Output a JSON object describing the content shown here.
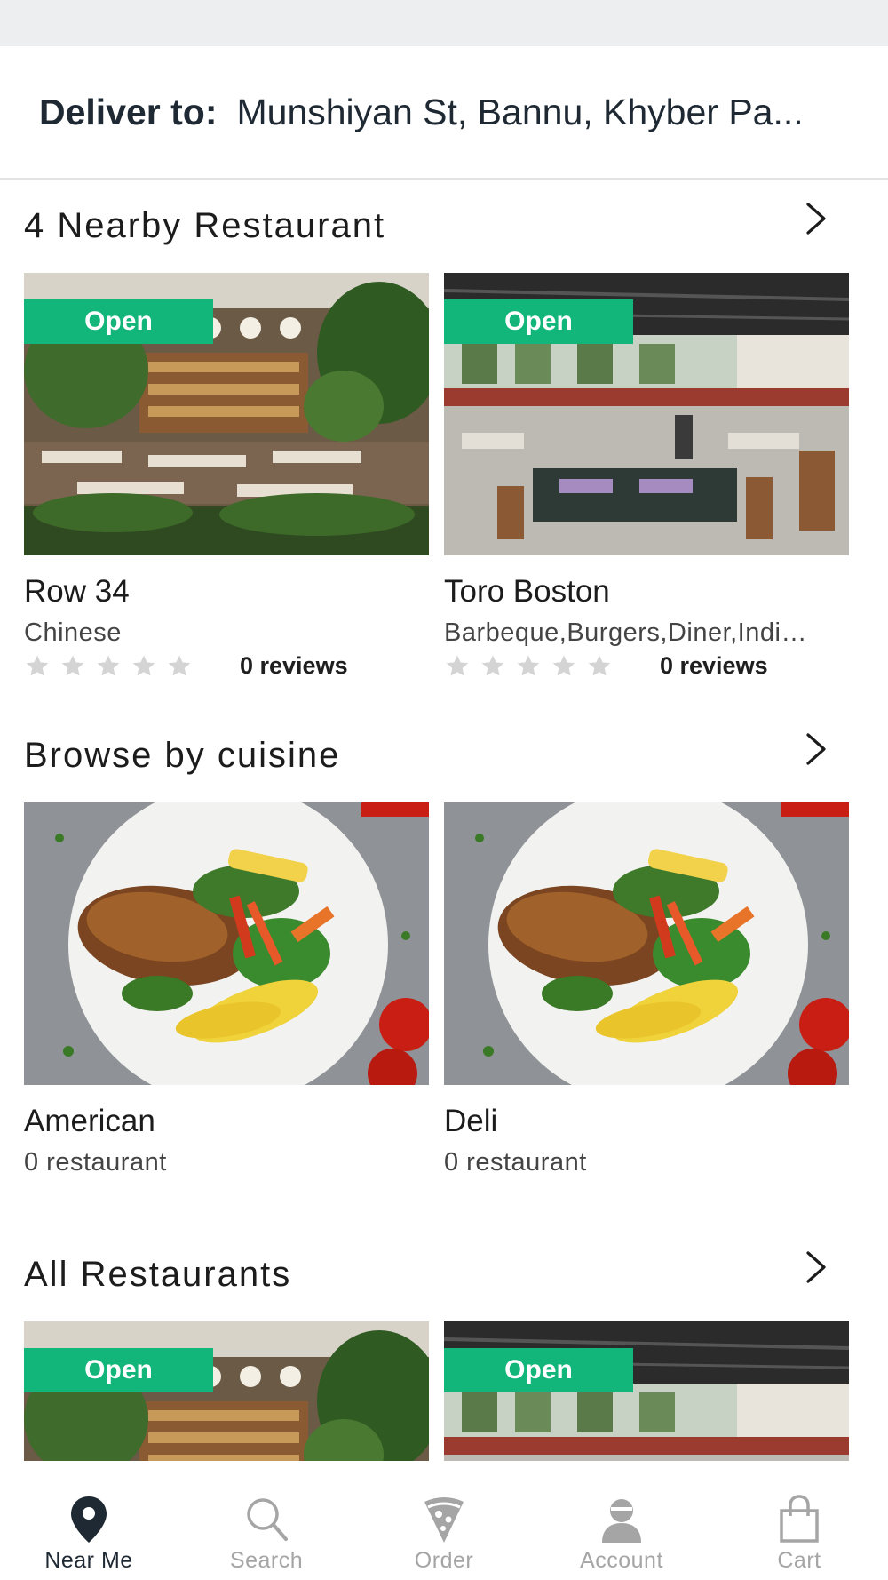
{
  "header": {
    "deliver_label": "Deliver to:",
    "deliver_address": "Munshiyan St, Bannu, Khyber Pa..."
  },
  "nearby": {
    "title": "4 Nearby Restaurant",
    "items": [
      {
        "badge": "Open",
        "name": "Row 34",
        "cuisine": "Chinese",
        "rating": 0,
        "reviews": "0 reviews"
      },
      {
        "badge": "Open",
        "name": "Toro Boston",
        "cuisine": "Barbeque,Burgers,Diner,Indi…",
        "rating": 0,
        "reviews": "0 reviews"
      }
    ]
  },
  "cuisine": {
    "title": "Browse by cuisine",
    "items": [
      {
        "name": "American",
        "count": "0 restaurant"
      },
      {
        "name": "Deli",
        "count": "0 restaurant"
      }
    ]
  },
  "all": {
    "title": "All Restaurants",
    "items": [
      {
        "badge": "Open"
      },
      {
        "badge": "Open"
      }
    ]
  },
  "tabs": [
    {
      "label": "Near Me",
      "icon": "location-pin-icon",
      "active": true
    },
    {
      "label": "Search",
      "icon": "search-icon",
      "active": false
    },
    {
      "label": "Order",
      "icon": "pizza-icon",
      "active": false
    },
    {
      "label": "Account",
      "icon": "account-icon",
      "active": false
    },
    {
      "label": "Cart",
      "icon": "shopping-bag-icon",
      "active": false
    }
  ],
  "colors": {
    "accent_green": "#12b57a",
    "active_tab": "#1f2933",
    "inactive_tab": "#a5a5a5"
  }
}
